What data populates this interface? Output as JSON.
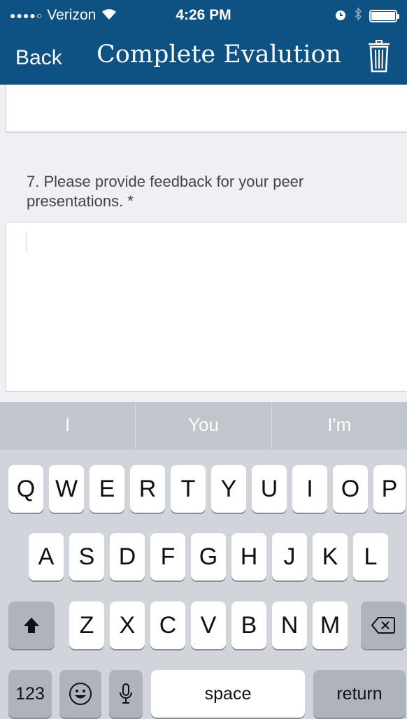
{
  "status_bar": {
    "signal": "●●●●○",
    "carrier": "Verizon",
    "time": "4:26 PM"
  },
  "nav": {
    "back_label": "Back",
    "title": "Complete Evalution",
    "trash_icon": "trash-icon"
  },
  "question": {
    "text": "7. Please provide feedback for your peer presentations. *"
  },
  "answer": {
    "value": ""
  },
  "keyboard": {
    "suggestions": [
      "I",
      "You",
      "I'm"
    ],
    "row1": [
      "Q",
      "W",
      "E",
      "R",
      "T",
      "Y",
      "U",
      "I",
      "O",
      "P"
    ],
    "row2": [
      "A",
      "S",
      "D",
      "F",
      "G",
      "H",
      "J",
      "K",
      "L"
    ],
    "row3": [
      "Z",
      "X",
      "C",
      "V",
      "B",
      "N",
      "M"
    ],
    "numbers_label": "123",
    "space_label": "space",
    "return_label": "return"
  },
  "colors": {
    "nav_bar": "#0e5183",
    "keyboard": "#d1d5db",
    "background": "#efeff4"
  }
}
